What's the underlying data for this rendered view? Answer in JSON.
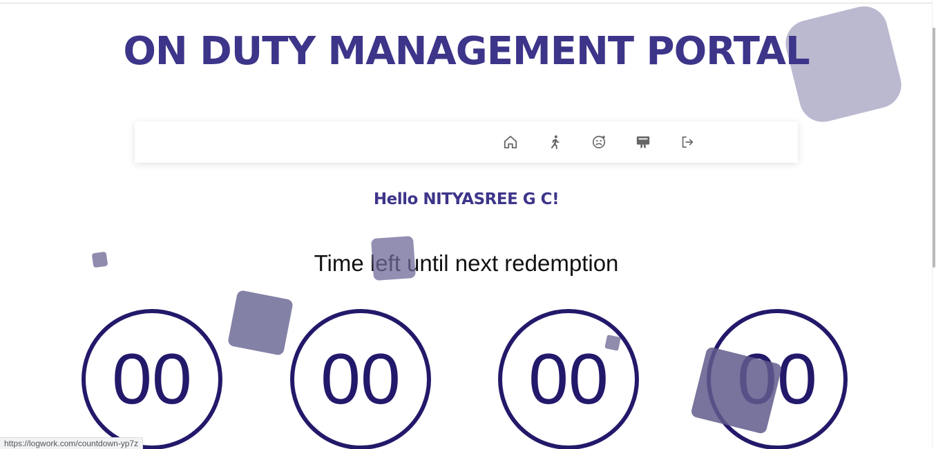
{
  "header": {
    "title": "ON DUTY MANAGEMENT PORTAL"
  },
  "nav": {
    "items": [
      {
        "name": "home",
        "icon": "home-icon"
      },
      {
        "name": "on-duty",
        "icon": "running-person-icon"
      },
      {
        "name": "leave",
        "icon": "sick-face-icon"
      },
      {
        "name": "certificate",
        "icon": "certificate-icon"
      },
      {
        "name": "logout",
        "icon": "logout-icon"
      }
    ]
  },
  "greeting": "Hello NITYASREE G C!",
  "countdown": {
    "label": "Time left until next redemption",
    "values": [
      "00",
      "00",
      "00",
      "00"
    ]
  },
  "status_bar": {
    "url": "https://logwork.com/countdown-yp7z"
  },
  "colors": {
    "brand": "#3d3589",
    "circle": "#23196a",
    "shape_dark": "#6e6a98",
    "shape_light": "#aaa8c4"
  }
}
